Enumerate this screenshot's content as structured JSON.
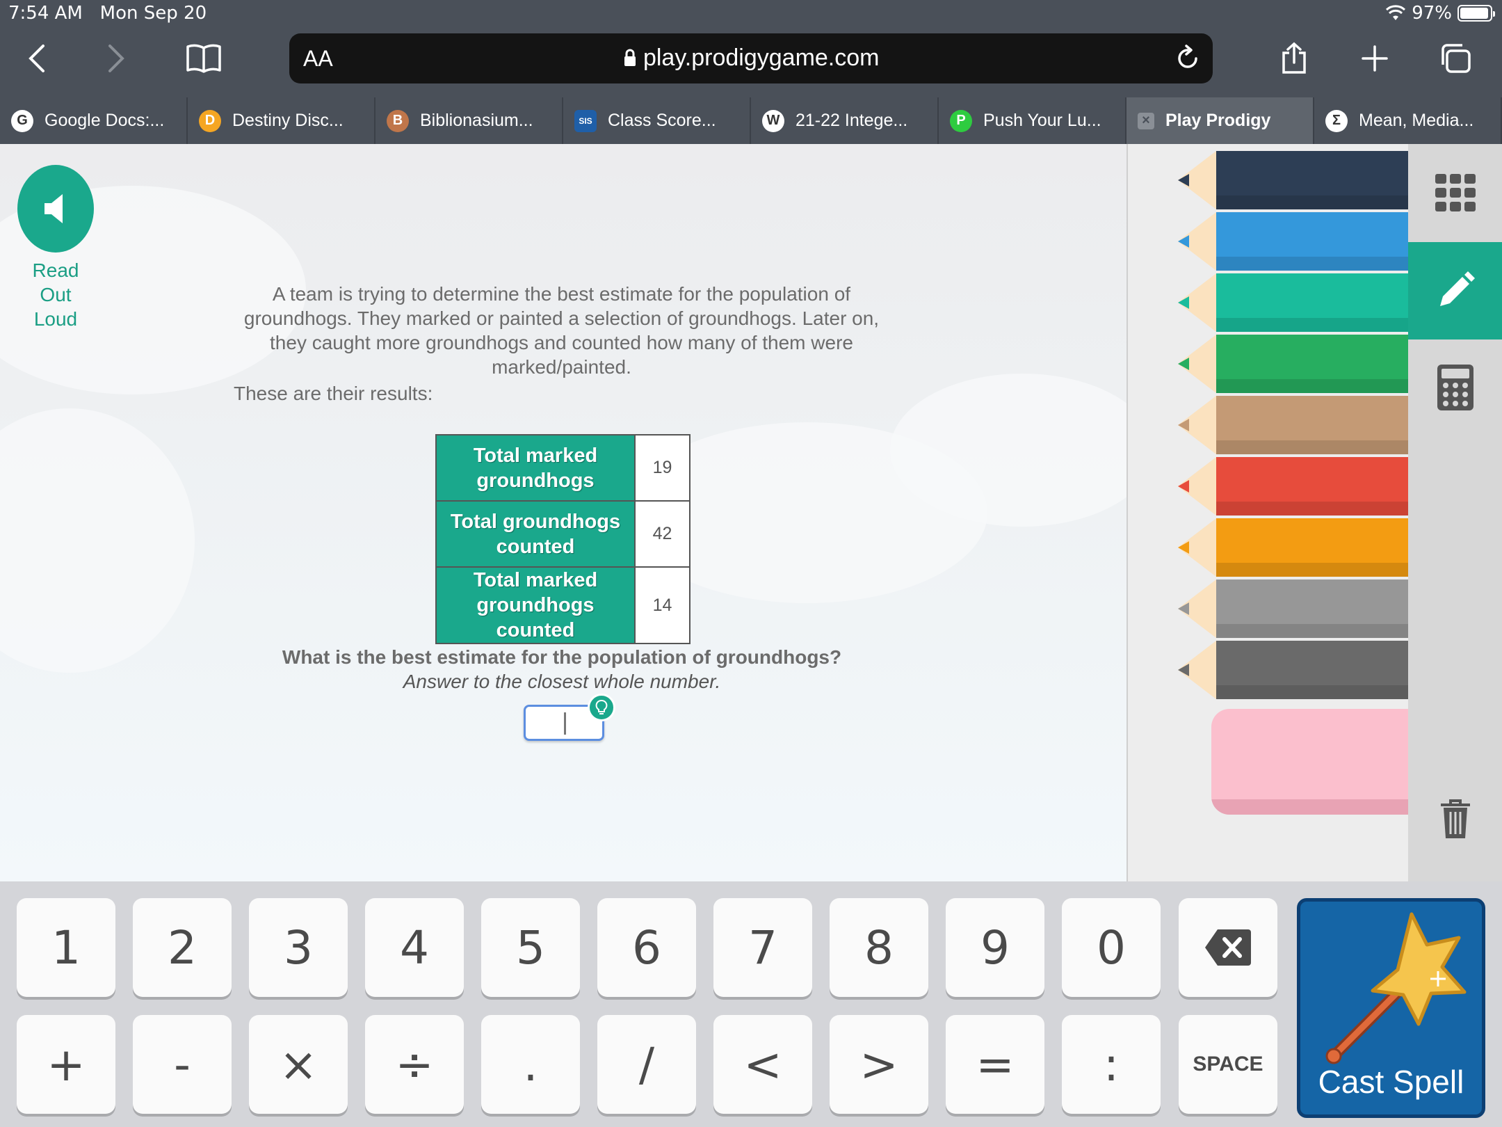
{
  "status": {
    "time": "7:54 AM",
    "date": "Mon Sep 20",
    "battery": "97%"
  },
  "browser": {
    "aa": "AA",
    "url": "play.prodigygame.com"
  },
  "tabs": [
    {
      "label": "Google Docs:...",
      "icon": "G",
      "color": "#ffffff",
      "active": false
    },
    {
      "label": "Destiny Disc...",
      "icon": "D",
      "color": "#f5a623",
      "active": false
    },
    {
      "label": "Biblionasium...",
      "icon": "B",
      "color": "#c0764a",
      "active": false
    },
    {
      "label": "Class Score...",
      "icon": "SIS",
      "color": "#1f5fa8",
      "active": false
    },
    {
      "label": "21-22 Intege...",
      "icon": "W",
      "color": "#ffffff",
      "active": false
    },
    {
      "label": "Push Your Lu...",
      "icon": "P",
      "color": "#2ecc40",
      "active": false
    },
    {
      "label": "Play Prodigy",
      "icon": "×",
      "color": "#8a8f96",
      "active": true
    },
    {
      "label": "Mean, Media...",
      "icon": "Σ",
      "color": "#ffffff",
      "active": false
    }
  ],
  "game": {
    "read_out_loud": "Read Out Loud",
    "question": "A team is trying to determine the best estimate for the population of groundhogs. They marked or painted a selection of groundhogs. Later on, they caught more groundhogs and counted how many of them were marked/painted.",
    "results_intro": "These are their results:",
    "table": [
      {
        "label": "Total marked groundhogs",
        "value": "19"
      },
      {
        "label": "Total groundhogs counted",
        "value": "42"
      },
      {
        "label": "Total marked groundhogs counted",
        "value": "14"
      }
    ],
    "ask": "What is the best estimate for the population of groundhogs?",
    "hint": "Answer to the closest whole number.",
    "answer_value": ""
  },
  "pencils": [
    "#2d3e55",
    "#3498db",
    "#1abc9c",
    "#27ae60",
    "#c49a75",
    "#e74c3c",
    "#f39c12",
    "#979797",
    "#6a6a6a"
  ],
  "keyboard": {
    "row1": [
      "1",
      "2",
      "3",
      "4",
      "5",
      "6",
      "7",
      "8",
      "9",
      "0"
    ],
    "row2": [
      "+",
      "-",
      "×",
      "÷",
      ".",
      "/",
      "<",
      ">",
      "=",
      ":"
    ],
    "space": "SPACE",
    "cast": "Cast Spell"
  },
  "colors": {
    "accent": "#1aa88c",
    "cast_bg": "#1565a6"
  }
}
